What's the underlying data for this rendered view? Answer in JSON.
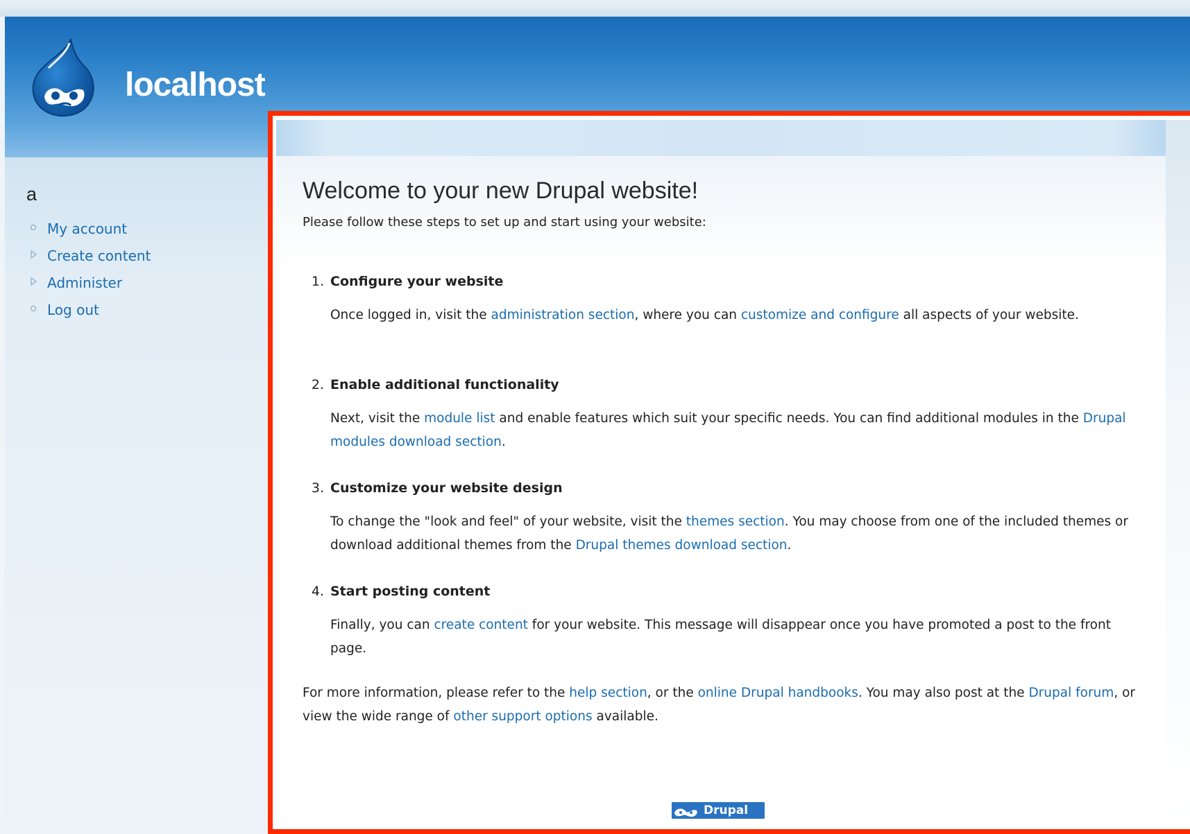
{
  "site": {
    "name": "localhost"
  },
  "sidebar": {
    "title": "a",
    "items": [
      {
        "label": "My account",
        "bullet": "circle"
      },
      {
        "label": "Create content",
        "bullet": "triangle"
      },
      {
        "label": "Administer",
        "bullet": "triangle"
      },
      {
        "label": "Log out",
        "bullet": "circle"
      }
    ]
  },
  "main": {
    "title": "Welcome to your new Drupal website!",
    "intro": "Please follow these steps to set up and start using your website:",
    "steps": [
      {
        "num": "1.",
        "heading": "Configure your website",
        "t1": "Once logged in, visit the ",
        "l1": "administration section",
        "t2": ", where you can ",
        "l2": "customize and configure",
        "t3": " all aspects of your website."
      },
      {
        "num": "2.",
        "heading": "Enable additional functionality",
        "t1": "Next, visit the ",
        "l1": "module list",
        "t2": " and enable features which suit your specific needs. You can find additional modules in the ",
        "l2": "Drupal modules download section",
        "t3": "."
      },
      {
        "num": "3.",
        "heading": "Customize your website design",
        "t1": "To change the \"look and feel\" of your website, visit the ",
        "l1": "themes section",
        "t2": ". You may choose from one of the included themes or download additional themes from the ",
        "l2": "Drupal themes download section",
        "t3": "."
      },
      {
        "num": "4.",
        "heading": "Start posting content",
        "t1": "Finally, you can ",
        "l1": "create content",
        "t2": " for your website. This message will disappear once you have promoted a post to the front page.",
        "l2": "",
        "t3": ""
      }
    ],
    "more_info": {
      "t1": "For more information, please refer to the ",
      "l1": "help section",
      "t2": ", or the ",
      "l2": "online Drupal handbooks",
      "t3": ". You may also post at the ",
      "l3": "Drupal forum",
      "t4": ", or view the wide range of ",
      "l4": "other support options",
      "t5": " available."
    }
  },
  "footer": {
    "powered_by": "Drupal"
  },
  "colors": {
    "link": "#1a6cb0",
    "highlight_border": "#ff2a00",
    "header": "#2a80c8"
  }
}
